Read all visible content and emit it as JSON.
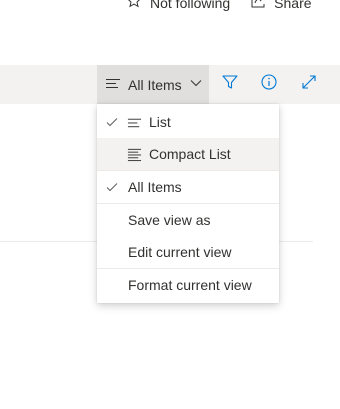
{
  "header": {
    "follow_label": "Not following",
    "share_label": "Share"
  },
  "command_bar": {
    "view_label": "All Items"
  },
  "view_menu": {
    "items": [
      {
        "label": "List",
        "checked": true,
        "icon": "list-icon"
      },
      {
        "label": "Compact List",
        "checked": false,
        "icon": "compact-list-icon",
        "highlighted": true
      },
      {
        "label": "All Items",
        "checked": true
      },
      {
        "label": "Save view as"
      },
      {
        "label": "Edit current view"
      },
      {
        "label": "Format current view"
      }
    ]
  },
  "colors": {
    "accent": "#0078d4",
    "command_bar_bg": "#f3f2f1",
    "button_active_bg": "#e1dfdd",
    "text": "#323130"
  }
}
